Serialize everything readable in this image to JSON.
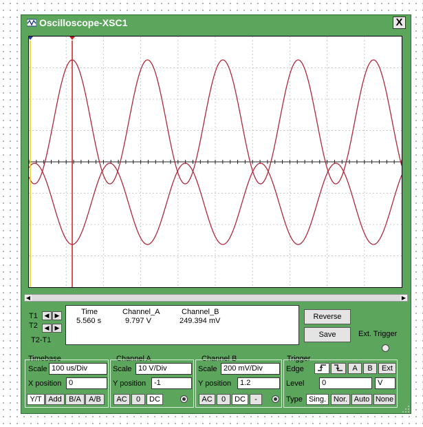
{
  "window": {
    "title": "Oscilloscope-XSC1",
    "close_label": "X",
    "accent": "#5ca55c"
  },
  "cursors": {
    "t1": "T1",
    "t2": "T2",
    "t2_t1": "T2-T1",
    "left_arrow": "◀",
    "right_arrow": "▶"
  },
  "readout": {
    "headers": [
      "Time",
      "Channel_A",
      "Channel_B"
    ],
    "values": [
      "5.560 s",
      "9.797 V",
      "249.394 mV"
    ]
  },
  "buttons": {
    "reverse": "Reverse",
    "save": "Save",
    "ext_trigger": "Ext. Trigger"
  },
  "timebase": {
    "title": "Timebase",
    "scale_label": "Scale",
    "scale_value": "100 us/Div",
    "xpos_label": "X position",
    "xpos_value": "0",
    "modes": [
      "Y/T",
      "Add",
      "B/A",
      "A/B"
    ],
    "selected_mode": "Y/T"
  },
  "channel_a": {
    "title": "Channel A",
    "scale_label": "Scale",
    "scale_value": "10  V/Div",
    "ypos_label": "Y position",
    "ypos_value": "-1",
    "coupling": [
      "AC",
      "0",
      "DC"
    ],
    "selected_coupling": "DC"
  },
  "channel_b": {
    "title": "Channel B",
    "scale_label": "Scale",
    "scale_value": "200 mV/Div",
    "ypos_label": "Y position",
    "ypos_value": "1.2",
    "coupling": [
      "AC",
      "0",
      "DC",
      "-"
    ],
    "selected_coupling": "DC"
  },
  "trigger": {
    "title": "Trigger",
    "edge_label": "Edge",
    "edge_buttons": [
      "⨏",
      "⨏",
      "A",
      "B",
      "Ext"
    ],
    "level_label": "Level",
    "level_value": "0",
    "level_unit": "V",
    "type_label": "Type",
    "types": [
      "Sing.",
      "Nor.",
      "Auto",
      "None"
    ],
    "selected_type": "Sing."
  },
  "trace_color": "#b0283a",
  "cursor1_color": "#f0d000",
  "cursor2_color": "#c81e1e"
}
